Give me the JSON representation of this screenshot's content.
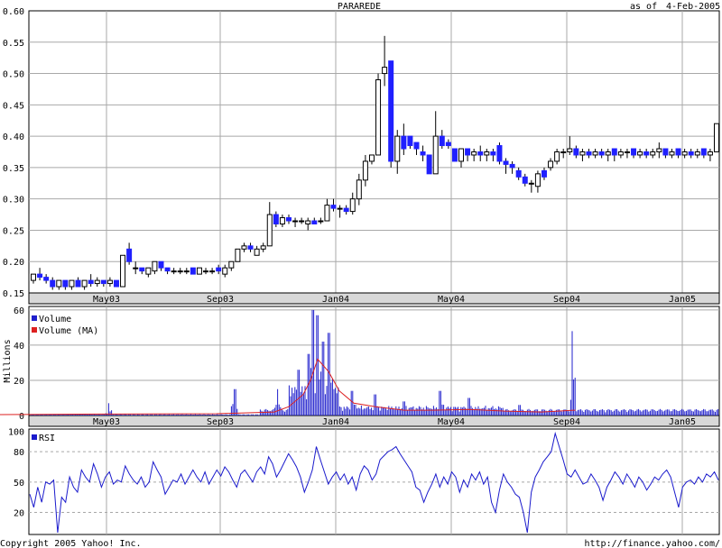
{
  "header": {
    "symbol": "PARAREDE",
    "as_of_label": "as of",
    "as_of_date": "4-Feb-2005"
  },
  "footer": {
    "copyright": "Copyright 2005 Yahoo! Inc.",
    "url": "http://finance.yahoo.com/"
  },
  "colors": {
    "up": "#ffffff",
    "down": "#2020ff",
    "volume": "#2020cc",
    "volume_ma": "#dd2020",
    "rsi": "#1a1acc",
    "grid": "#a8a8a8",
    "band": "#d8d8d8"
  },
  "chart_data": [
    {
      "type": "candlestick",
      "title": "PARAREDE",
      "x_ticks": [
        "May03",
        "Sep03",
        "Jan04",
        "May04",
        "Sep04",
        "Jan05"
      ],
      "y_ticks": [
        "0.15",
        "0.20",
        "0.25",
        "0.30",
        "0.35",
        "0.40",
        "0.45",
        "0.50",
        "0.55",
        "0.60"
      ],
      "ylim": [
        0.15,
        0.6
      ],
      "ohlc": [
        {
          "o": 0.17,
          "h": 0.18,
          "l": 0.165,
          "c": 0.18
        },
        {
          "o": 0.18,
          "h": 0.19,
          "l": 0.17,
          "c": 0.175
        },
        {
          "o": 0.175,
          "h": 0.18,
          "l": 0.165,
          "c": 0.17
        },
        {
          "o": 0.17,
          "h": 0.175,
          "l": 0.155,
          "c": 0.16
        },
        {
          "o": 0.16,
          "h": 0.17,
          "l": 0.155,
          "c": 0.17
        },
        {
          "o": 0.17,
          "h": 0.17,
          "l": 0.155,
          "c": 0.16
        },
        {
          "o": 0.16,
          "h": 0.17,
          "l": 0.155,
          "c": 0.17
        },
        {
          "o": 0.17,
          "h": 0.175,
          "l": 0.16,
          "c": 0.16
        },
        {
          "o": 0.16,
          "h": 0.17,
          "l": 0.155,
          "c": 0.17
        },
        {
          "o": 0.17,
          "h": 0.18,
          "l": 0.16,
          "c": 0.165
        },
        {
          "o": 0.165,
          "h": 0.175,
          "l": 0.16,
          "c": 0.17
        },
        {
          "o": 0.17,
          "h": 0.17,
          "l": 0.16,
          "c": 0.165
        },
        {
          "o": 0.165,
          "h": 0.175,
          "l": 0.16,
          "c": 0.17
        },
        {
          "o": 0.17,
          "h": 0.17,
          "l": 0.16,
          "c": 0.16
        },
        {
          "o": 0.16,
          "h": 0.21,
          "l": 0.16,
          "c": 0.21
        },
        {
          "o": 0.22,
          "h": 0.23,
          "l": 0.195,
          "c": 0.2
        },
        {
          "o": 0.19,
          "h": 0.2,
          "l": 0.18,
          "c": 0.19
        },
        {
          "o": 0.19,
          "h": 0.19,
          "l": 0.18,
          "c": 0.185
        },
        {
          "o": 0.18,
          "h": 0.19,
          "l": 0.175,
          "c": 0.19
        },
        {
          "o": 0.185,
          "h": 0.2,
          "l": 0.18,
          "c": 0.2
        },
        {
          "o": 0.2,
          "h": 0.2,
          "l": 0.185,
          "c": 0.19
        },
        {
          "o": 0.19,
          "h": 0.19,
          "l": 0.18,
          "c": 0.185
        },
        {
          "o": 0.185,
          "h": 0.19,
          "l": 0.18,
          "c": 0.185
        },
        {
          "o": 0.185,
          "h": 0.19,
          "l": 0.18,
          "c": 0.185
        },
        {
          "o": 0.185,
          "h": 0.19,
          "l": 0.18,
          "c": 0.185
        },
        {
          "o": 0.19,
          "h": 0.19,
          "l": 0.18,
          "c": 0.18
        },
        {
          "o": 0.18,
          "h": 0.19,
          "l": 0.18,
          "c": 0.19
        },
        {
          "o": 0.185,
          "h": 0.19,
          "l": 0.18,
          "c": 0.185
        },
        {
          "o": 0.185,
          "h": 0.19,
          "l": 0.18,
          "c": 0.185
        },
        {
          "o": 0.19,
          "h": 0.195,
          "l": 0.18,
          "c": 0.185
        },
        {
          "o": 0.18,
          "h": 0.195,
          "l": 0.175,
          "c": 0.19
        },
        {
          "o": 0.19,
          "h": 0.2,
          "l": 0.185,
          "c": 0.2
        },
        {
          "o": 0.2,
          "h": 0.22,
          "l": 0.2,
          "c": 0.22
        },
        {
          "o": 0.22,
          "h": 0.23,
          "l": 0.215,
          "c": 0.225
        },
        {
          "o": 0.225,
          "h": 0.23,
          "l": 0.215,
          "c": 0.22
        },
        {
          "o": 0.21,
          "h": 0.225,
          "l": 0.21,
          "c": 0.22
        },
        {
          "o": 0.22,
          "h": 0.23,
          "l": 0.215,
          "c": 0.225
        },
        {
          "o": 0.225,
          "h": 0.295,
          "l": 0.225,
          "c": 0.275
        },
        {
          "o": 0.275,
          "h": 0.28,
          "l": 0.255,
          "c": 0.26
        },
        {
          "o": 0.26,
          "h": 0.275,
          "l": 0.255,
          "c": 0.27
        },
        {
          "o": 0.27,
          "h": 0.275,
          "l": 0.26,
          "c": 0.265
        },
        {
          "o": 0.265,
          "h": 0.27,
          "l": 0.255,
          "c": 0.265
        },
        {
          "o": 0.265,
          "h": 0.27,
          "l": 0.26,
          "c": 0.265
        },
        {
          "o": 0.26,
          "h": 0.27,
          "l": 0.25,
          "c": 0.265
        },
        {
          "o": 0.265,
          "h": 0.27,
          "l": 0.26,
          "c": 0.26
        },
        {
          "o": 0.265,
          "h": 0.27,
          "l": 0.26,
          "c": 0.265
        },
        {
          "o": 0.265,
          "h": 0.3,
          "l": 0.265,
          "c": 0.29
        },
        {
          "o": 0.29,
          "h": 0.3,
          "l": 0.28,
          "c": 0.285
        },
        {
          "o": 0.285,
          "h": 0.29,
          "l": 0.27,
          "c": 0.285
        },
        {
          "o": 0.285,
          "h": 0.29,
          "l": 0.275,
          "c": 0.28
        },
        {
          "o": 0.28,
          "h": 0.31,
          "l": 0.275,
          "c": 0.3
        },
        {
          "o": 0.3,
          "h": 0.34,
          "l": 0.29,
          "c": 0.33
        },
        {
          "o": 0.33,
          "h": 0.37,
          "l": 0.32,
          "c": 0.36
        },
        {
          "o": 0.36,
          "h": 0.37,
          "l": 0.355,
          "c": 0.37
        },
        {
          "o": 0.37,
          "h": 0.5,
          "l": 0.37,
          "c": 0.49
        },
        {
          "o": 0.5,
          "h": 0.56,
          "l": 0.48,
          "c": 0.51
        },
        {
          "o": 0.52,
          "h": 0.52,
          "l": 0.35,
          "c": 0.36
        },
        {
          "o": 0.36,
          "h": 0.41,
          "l": 0.34,
          "c": 0.4
        },
        {
          "o": 0.4,
          "h": 0.42,
          "l": 0.37,
          "c": 0.38
        },
        {
          "o": 0.4,
          "h": 0.4,
          "l": 0.38,
          "c": 0.385
        },
        {
          "o": 0.39,
          "h": 0.39,
          "l": 0.37,
          "c": 0.38
        },
        {
          "o": 0.375,
          "h": 0.385,
          "l": 0.36,
          "c": 0.37
        },
        {
          "o": 0.37,
          "h": 0.37,
          "l": 0.34,
          "c": 0.34
        },
        {
          "o": 0.34,
          "h": 0.44,
          "l": 0.34,
          "c": 0.4
        },
        {
          "o": 0.4,
          "h": 0.41,
          "l": 0.38,
          "c": 0.385
        },
        {
          "o": 0.39,
          "h": 0.395,
          "l": 0.38,
          "c": 0.385
        },
        {
          "o": 0.38,
          "h": 0.38,
          "l": 0.36,
          "c": 0.36
        },
        {
          "o": 0.36,
          "h": 0.38,
          "l": 0.35,
          "c": 0.38
        },
        {
          "o": 0.38,
          "h": 0.38,
          "l": 0.36,
          "c": 0.37
        },
        {
          "o": 0.37,
          "h": 0.38,
          "l": 0.36,
          "c": 0.375
        },
        {
          "o": 0.375,
          "h": 0.385,
          "l": 0.36,
          "c": 0.37
        },
        {
          "o": 0.37,
          "h": 0.38,
          "l": 0.36,
          "c": 0.375
        },
        {
          "o": 0.375,
          "h": 0.38,
          "l": 0.36,
          "c": 0.37
        },
        {
          "o": 0.385,
          "h": 0.39,
          "l": 0.355,
          "c": 0.36
        },
        {
          "o": 0.36,
          "h": 0.365,
          "l": 0.34,
          "c": 0.355
        },
        {
          "o": 0.355,
          "h": 0.36,
          "l": 0.34,
          "c": 0.35
        },
        {
          "o": 0.345,
          "h": 0.35,
          "l": 0.33,
          "c": 0.335
        },
        {
          "o": 0.335,
          "h": 0.34,
          "l": 0.32,
          "c": 0.325
        },
        {
          "o": 0.325,
          "h": 0.33,
          "l": 0.31,
          "c": 0.325
        },
        {
          "o": 0.32,
          "h": 0.345,
          "l": 0.31,
          "c": 0.34
        },
        {
          "o": 0.345,
          "h": 0.35,
          "l": 0.33,
          "c": 0.335
        },
        {
          "o": 0.35,
          "h": 0.365,
          "l": 0.345,
          "c": 0.36
        },
        {
          "o": 0.36,
          "h": 0.38,
          "l": 0.355,
          "c": 0.375
        },
        {
          "o": 0.375,
          "h": 0.38,
          "l": 0.365,
          "c": 0.375
        },
        {
          "o": 0.375,
          "h": 0.4,
          "l": 0.37,
          "c": 0.38
        },
        {
          "o": 0.38,
          "h": 0.385,
          "l": 0.365,
          "c": 0.37
        },
        {
          "o": 0.37,
          "h": 0.38,
          "l": 0.36,
          "c": 0.375
        },
        {
          "o": 0.375,
          "h": 0.38,
          "l": 0.365,
          "c": 0.37
        },
        {
          "o": 0.37,
          "h": 0.38,
          "l": 0.365,
          "c": 0.375
        },
        {
          "o": 0.375,
          "h": 0.38,
          "l": 0.365,
          "c": 0.37
        },
        {
          "o": 0.37,
          "h": 0.38,
          "l": 0.36,
          "c": 0.375
        },
        {
          "o": 0.38,
          "h": 0.38,
          "l": 0.36,
          "c": 0.37
        },
        {
          "o": 0.37,
          "h": 0.38,
          "l": 0.365,
          "c": 0.375
        },
        {
          "o": 0.375,
          "h": 0.38,
          "l": 0.365,
          "c": 0.375
        },
        {
          "o": 0.38,
          "h": 0.38,
          "l": 0.365,
          "c": 0.37
        },
        {
          "o": 0.37,
          "h": 0.38,
          "l": 0.365,
          "c": 0.375
        },
        {
          "o": 0.375,
          "h": 0.38,
          "l": 0.365,
          "c": 0.37
        },
        {
          "o": 0.37,
          "h": 0.38,
          "l": 0.365,
          "c": 0.375
        },
        {
          "o": 0.375,
          "h": 0.39,
          "l": 0.365,
          "c": 0.38
        },
        {
          "o": 0.38,
          "h": 0.38,
          "l": 0.365,
          "c": 0.37
        },
        {
          "o": 0.37,
          "h": 0.38,
          "l": 0.365,
          "c": 0.375
        },
        {
          "o": 0.38,
          "h": 0.38,
          "l": 0.365,
          "c": 0.37
        },
        {
          "o": 0.37,
          "h": 0.38,
          "l": 0.365,
          "c": 0.375
        },
        {
          "o": 0.375,
          "h": 0.38,
          "l": 0.365,
          "c": 0.37
        },
        {
          "o": 0.37,
          "h": 0.38,
          "l": 0.365,
          "c": 0.375
        },
        {
          "o": 0.38,
          "h": 0.38,
          "l": 0.365,
          "c": 0.37
        },
        {
          "o": 0.37,
          "h": 0.38,
          "l": 0.36,
          "c": 0.375
        },
        {
          "o": 0.375,
          "h": 0.42,
          "l": 0.375,
          "c": 0.42
        }
      ]
    },
    {
      "type": "bar",
      "ylabel": "Millions",
      "legend": [
        {
          "name": "Volume"
        },
        {
          "name": "Volume (MA)"
        }
      ],
      "x_ticks": [
        "May03",
        "Sep03",
        "Jan04",
        "May04",
        "Sep04",
        "Jan05"
      ],
      "y_ticks": [
        "0",
        "20",
        "40",
        "60"
      ],
      "ylim": [
        0,
        62
      ],
      "volume_peaks": [
        {
          "x": 0.15,
          "v": 7
        },
        {
          "x": 0.325,
          "v": 15
        },
        {
          "x": 0.385,
          "v": 15
        },
        {
          "x": 0.414,
          "v": 26
        },
        {
          "x": 0.428,
          "v": 35
        },
        {
          "x": 0.434,
          "v": 60
        },
        {
          "x": 0.44,
          "v": 57
        },
        {
          "x": 0.448,
          "v": 42
        },
        {
          "x": 0.456,
          "v": 47
        },
        {
          "x": 0.462,
          "v": 15
        },
        {
          "x": 0.488,
          "v": 14
        },
        {
          "x": 0.52,
          "v": 12
        },
        {
          "x": 0.56,
          "v": 8
        },
        {
          "x": 0.61,
          "v": 14
        },
        {
          "x": 0.65,
          "v": 10
        },
        {
          "x": 0.72,
          "v": 6
        },
        {
          "x": 0.793,
          "v": 48
        }
      ],
      "volume_ma": [
        [
          0.0,
          0.5
        ],
        [
          0.14,
          0.8
        ],
        [
          0.3,
          1.0
        ],
        [
          0.38,
          2.0
        ],
        [
          0.4,
          5
        ],
        [
          0.42,
          12
        ],
        [
          0.43,
          20
        ],
        [
          0.44,
          32
        ],
        [
          0.455,
          25
        ],
        [
          0.47,
          14
        ],
        [
          0.49,
          7
        ],
        [
          0.52,
          5
        ],
        [
          0.56,
          3
        ],
        [
          0.6,
          3
        ],
        [
          0.65,
          3.5
        ],
        [
          0.7,
          2.5
        ],
        [
          0.75,
          2
        ],
        [
          0.797,
          3
        ]
      ]
    },
    {
      "type": "line",
      "legend": [
        {
          "name": "RSI"
        }
      ],
      "x_ticks": [
        "May03",
        "Sep03",
        "Jan04",
        "May04",
        "Sep04",
        "Jan05"
      ],
      "y_ticks": [
        "20",
        "50",
        "80",
        "100"
      ],
      "ylim": [
        0,
        100
      ],
      "series": [
        {
          "values": [
            38,
            25,
            45,
            30,
            50,
            48,
            52,
            0,
            35,
            30,
            55,
            45,
            40,
            62,
            55,
            50,
            68,
            58,
            45,
            55,
            60,
            48,
            52,
            50,
            66,
            58,
            52,
            48,
            55,
            45,
            50,
            70,
            62,
            55,
            38,
            45,
            52,
            50,
            58,
            48,
            55,
            62,
            55,
            50,
            60,
            48,
            55,
            62,
            56,
            65,
            60,
            52,
            45,
            58,
            62,
            56,
            50,
            60,
            65,
            58,
            75,
            68,
            55,
            62,
            70,
            78,
            72,
            65,
            55,
            40,
            50,
            62,
            85,
            72,
            60,
            48,
            55,
            60,
            52,
            58,
            48,
            55,
            42,
            58,
            66,
            62,
            52,
            58,
            72,
            76,
            80,
            82,
            85,
            78,
            72,
            66,
            60,
            45,
            42,
            30,
            40,
            48,
            58,
            45,
            55,
            48,
            60,
            55,
            40,
            52,
            45,
            58,
            52,
            60,
            48,
            55,
            30,
            20,
            42,
            58,
            50,
            45,
            38,
            35,
            20,
            0,
            40,
            55,
            62,
            70,
            75,
            80,
            98,
            85,
            72,
            58,
            55,
            62,
            55,
            48,
            50,
            58,
            52,
            45,
            32,
            45,
            52,
            60,
            55,
            48,
            58,
            52,
            45,
            55,
            50,
            42,
            48,
            55,
            52,
            58,
            62,
            55,
            40,
            25,
            45,
            50,
            52,
            48,
            55,
            50,
            58,
            55,
            60,
            52
          ]
        }
      ],
      "hlines": [
        20,
        50,
        80
      ]
    }
  ]
}
